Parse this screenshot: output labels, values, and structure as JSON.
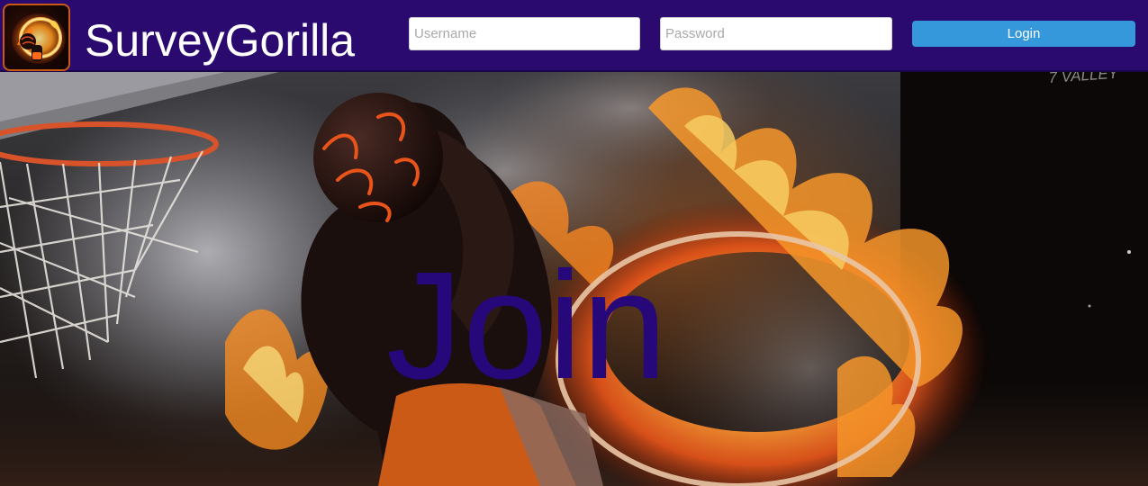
{
  "app": {
    "brand_name": "SurveyGorilla"
  },
  "login_form": {
    "username_placeholder": "Username",
    "password_placeholder": "Password",
    "username_value": "",
    "password_value": "",
    "login_label": "Login"
  },
  "hero": {
    "headline": "Join",
    "image_text": "7 VALLEY"
  },
  "colors": {
    "header_background": "#2a0a6e",
    "login_button": "#3498db",
    "headline": "#26087a",
    "logo_border": "#c85a15"
  },
  "icons": {
    "logo": "flaming-basketball-hoop-logo"
  }
}
